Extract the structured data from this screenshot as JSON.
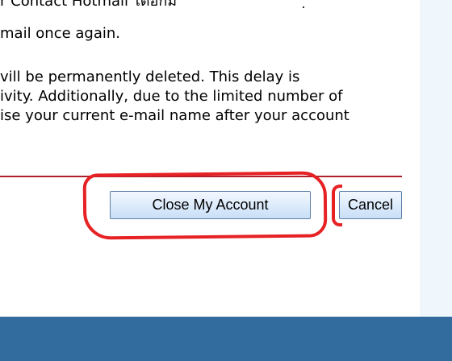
{
  "top_fragment_text": "r Contact Hotmail ได้อีกมี",
  "lines": [
    "mail once again.",
    "vill be permanently deleted. This delay is",
    "ivity. Additionally, due to the limited number of",
    "ise your current e-mail name after your account"
  ],
  "buttons": {
    "close_my_account": "Close My Account",
    "cancel": "Cancel"
  },
  "colors": {
    "divider": "#b11f2a",
    "annotation": "#e62225",
    "right_panel": "#eff7fc",
    "bottom_bar": "#326c9f"
  }
}
